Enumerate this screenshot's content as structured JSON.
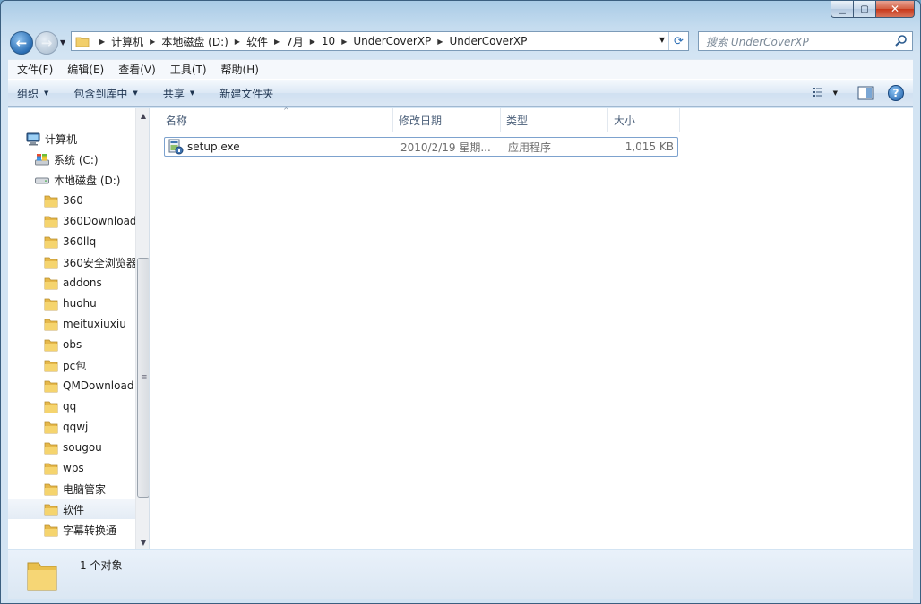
{
  "window": {
    "caption_buttons": [
      "minimize-icon",
      "maximize-icon",
      "close-icon"
    ]
  },
  "address": {
    "crumbs": [
      "计算机",
      "本地磁盘 (D:)",
      "软件",
      "7月",
      "10",
      "UnderCoverXP",
      "UnderCoverXP"
    ]
  },
  "search": {
    "placeholder": "搜索 UnderCoverXP"
  },
  "menu": {
    "items": [
      "文件(F)",
      "编辑(E)",
      "查看(V)",
      "工具(T)",
      "帮助(H)"
    ]
  },
  "toolbar": {
    "organize": "组织",
    "include_in_library": "包含到库中",
    "share": "共享",
    "new_folder": "新建文件夹"
  },
  "nav_tree": {
    "computer": "计算机",
    "drive_c": "系统 (C:)",
    "drive_d": "本地磁盘 (D:)",
    "folders": [
      "360",
      "360Download",
      "360llq",
      "360安全浏览器",
      "addons",
      "huohu",
      "meituxiuxiu",
      "obs",
      "pc包",
      "QMDownload",
      "qq",
      "qqwj",
      "sougou",
      "wps",
      "电脑管家",
      "软件",
      "字幕转换通"
    ],
    "selected": "软件"
  },
  "columns": {
    "name": "名称",
    "date_modified": "修改日期",
    "type": "类型",
    "size": "大小"
  },
  "files": [
    {
      "name": "setup.exe",
      "date_modified": "2010/2/19 星期...",
      "type": "应用程序",
      "size": "1,015 KB"
    }
  ],
  "status": {
    "count": "1 个对象"
  },
  "colors": {
    "accent": "#2a6db3",
    "selection_border": "#7da2ce",
    "toolbar": "#dce8f5"
  }
}
